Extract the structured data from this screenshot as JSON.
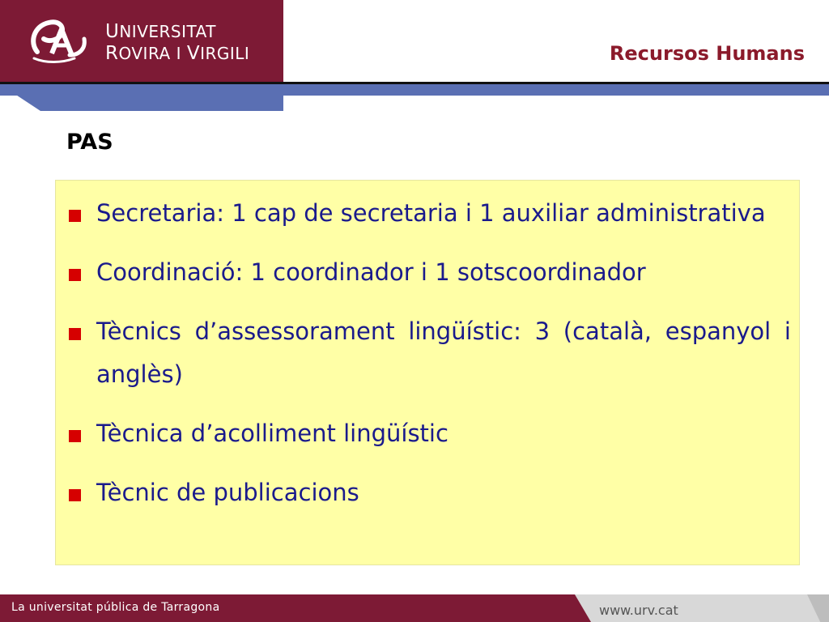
{
  "header": {
    "logo_line1_first": "U",
    "logo_line1_rest": "NIVERSITAT",
    "logo_line2_first": "R",
    "logo_line2_mid": "OVIRA I ",
    "logo_line2_cap2": "V",
    "logo_line2_rest": "IRGILI",
    "title": "Recursos Humans"
  },
  "main": {
    "section_title": "PAS",
    "bullets": [
      "Secretaria: 1 cap de secretaria i 1 auxiliar administrativa",
      "Coordinació: 1 coordinador i 1 sotscoordinador",
      "Tècnics d’assessorament lingüístic: 3 (català, espanyol i anglès)",
      "Tècnica d’acolliment lingüístic",
      "Tècnic de publicacions"
    ]
  },
  "footer": {
    "tagline": "La universitat pública de Tarragona",
    "url": "www.urv.cat"
  },
  "colors": {
    "brand": "#7d1a35",
    "accent_blue": "#5a6fb3",
    "box_bg": "#ffffa6",
    "bullet_text": "#1a1a8c",
    "bullet_marker": "#d60000"
  }
}
